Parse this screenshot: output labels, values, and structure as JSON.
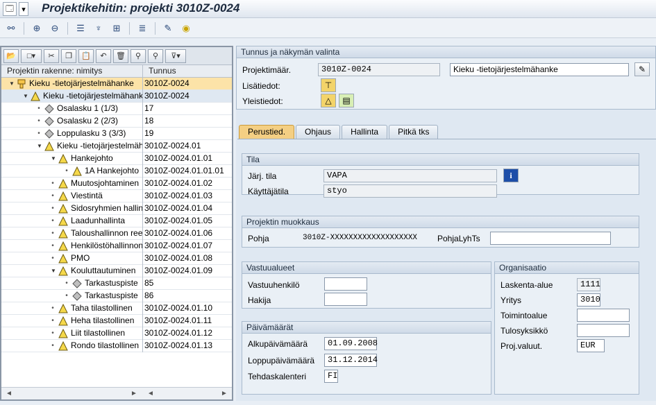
{
  "title": "Projektikehitin: projekti 3010Z-0024",
  "icons": {
    "title_left": [
      "sap-menu-icon"
    ],
    "appbar": [
      "glasses-icon",
      "node-expand-icon",
      "node-collapse-icon",
      "hierarchy-icon",
      "structure-icon",
      "network-icon",
      "filter-icon",
      "edit-table-icon",
      "cycle-icon"
    ],
    "lefttoolbar": [
      "open-folder-icon",
      "new-icon",
      "cut-icon",
      "copy-icon",
      "paste-icon",
      "undo-icon",
      "delete-icon",
      "binoculars-icon",
      "binoculars-next-icon",
      "filter-icon"
    ]
  },
  "tree": {
    "col1": "Projektin rakenne: nimitys",
    "col2": "Tunnus",
    "rows": [
      {
        "indent": 0,
        "exp": "▼",
        "icon": "project",
        "label": "Kieku -tietojärjestelmähanke",
        "code": "3010Z-0024",
        "selected": true
      },
      {
        "indent": 1,
        "exp": "▼",
        "icon": "triangle",
        "label": "Kieku -tietojärjestelmähanke",
        "code": "3010Z-0024",
        "alt": true
      },
      {
        "indent": 2,
        "exp": "•",
        "icon": "diamond",
        "label": "Osalasku 1 (1/3)",
        "code": "17"
      },
      {
        "indent": 2,
        "exp": "•",
        "icon": "diamond",
        "label": "Osalasku 2 (2/3)",
        "code": "18"
      },
      {
        "indent": 2,
        "exp": "•",
        "icon": "diamond",
        "label": "Loppulasku 3 (3/3)",
        "code": "19"
      },
      {
        "indent": 2,
        "exp": "▼",
        "icon": "triangle",
        "label": "Kieku -tietojärjestelmähanke",
        "code": "3010Z-0024.01"
      },
      {
        "indent": 3,
        "exp": "▼",
        "icon": "triangle",
        "label": "Hankejohto",
        "code": "3010Z-0024.01.01"
      },
      {
        "indent": 4,
        "exp": "•",
        "icon": "triangle",
        "label": "1A Hankejohto",
        "code": "3010Z-0024.01.01.01"
      },
      {
        "indent": 3,
        "exp": "•",
        "icon": "triangle",
        "label": "Muutosjohtaminen",
        "code": "3010Z-0024.01.02"
      },
      {
        "indent": 3,
        "exp": "•",
        "icon": "triangle",
        "label": "Viestintä",
        "code": "3010Z-0024.01.03"
      },
      {
        "indent": 3,
        "exp": "•",
        "icon": "triangle",
        "label": "Sidosryhmien hallinta",
        "code": "3010Z-0024.01.04"
      },
      {
        "indent": 3,
        "exp": "•",
        "icon": "triangle",
        "label": "Laadunhallinta",
        "code": "3010Z-0024.01.05"
      },
      {
        "indent": 3,
        "exp": "•",
        "icon": "triangle",
        "label": "Taloushallinnon reengineering",
        "code": "3010Z-0024.01.06"
      },
      {
        "indent": 3,
        "exp": "•",
        "icon": "triangle",
        "label": "Henkilöstöhallinnon",
        "code": "3010Z-0024.01.07"
      },
      {
        "indent": 3,
        "exp": "•",
        "icon": "triangle",
        "label": "PMO",
        "code": "3010Z-0024.01.08"
      },
      {
        "indent": 3,
        "exp": "▼",
        "icon": "triangle",
        "label": "Kouluttautuminen",
        "code": "3010Z-0024.01.09"
      },
      {
        "indent": 4,
        "exp": "•",
        "icon": "diamond",
        "label": "Tarkastuspiste",
        "code": "85"
      },
      {
        "indent": 4,
        "exp": "•",
        "icon": "diamond",
        "label": "Tarkastuspiste",
        "code": "86"
      },
      {
        "indent": 3,
        "exp": "•",
        "icon": "triangle",
        "label": "Taha tilastollinen",
        "code": "3010Z-0024.01.10"
      },
      {
        "indent": 3,
        "exp": "•",
        "icon": "triangle",
        "label": "Heha tilastollinen",
        "code": "3010Z-0024.01.11"
      },
      {
        "indent": 3,
        "exp": "•",
        "icon": "triangle",
        "label": "Liit  tilastollinen",
        "code": "3010Z-0024.01.12"
      },
      {
        "indent": 3,
        "exp": "•",
        "icon": "triangle",
        "label": "Rondo tilastollinen",
        "code": "3010Z-0024.01.13"
      }
    ],
    "scroll_left": "◄",
    "scroll_right": "►"
  },
  "header_group": {
    "title": "Tunnus ja näkymän valinta",
    "projektimaar_label": "Projektimäär.",
    "projektimaar_value": "3010Z-0024",
    "name_value": "Kieku -tietojärjestelmähanke",
    "lisatiedot_label": "Lisätiedot:",
    "yleistiedot_label": "Yleistiedot:"
  },
  "tabs": [
    "Perustied.",
    "Ohjaus",
    "Hallinta",
    "Pitkä tks"
  ],
  "tila": {
    "title": "Tila",
    "jarj_label": "Järj. tila",
    "jarj_value": "VAPA",
    "kayttaja_label": "Käyttäjätila",
    "kayttaja_value": "styo"
  },
  "muokkaus": {
    "title": "Projektin muokkaus",
    "pohja_label": "Pohja",
    "pohja_value": "3010Z-XXXXXXXXXXXXXXXXXXX",
    "pohjalyh_label": "PohjaLyhTs",
    "pohjalyh_value": ""
  },
  "vastuu": {
    "title": "Vastuualueet",
    "vastuuhenkilo_label": "Vastuuhenkilö",
    "hakija_label": "Hakija"
  },
  "paivamaarat": {
    "title": "Päivämäärät",
    "alku_label": "Alkupäivämäärä",
    "alku_value": "01.09.2008",
    "loppu_label": "Loppupäivämäärä",
    "loppu_value": "31.12.2014",
    "tehdas_label": "Tehdaskalenteri",
    "tehdas_value": "FI"
  },
  "organisaatio": {
    "title": "Organisaatio",
    "laskenta_label": "Laskenta-alue",
    "laskenta_value": "1111",
    "yritys_label": "Yritys",
    "yritys_value": "3010",
    "toiminto_label": "Toimintoalue",
    "tulos_label": "Tulosyksikkö",
    "valuutta_label": "Proj.valuut.",
    "valuutta_value": "EUR"
  }
}
